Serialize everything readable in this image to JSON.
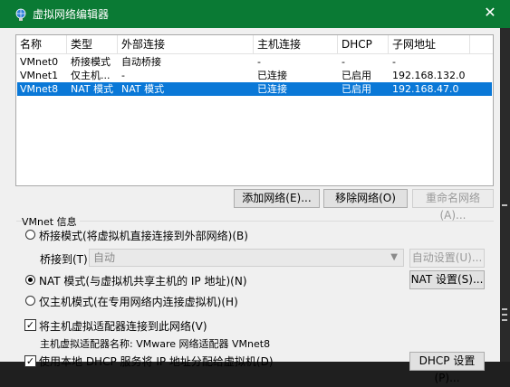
{
  "window": {
    "title": "虚拟网络编辑器",
    "close_glyph": "✕"
  },
  "table": {
    "columns": [
      "名称",
      "类型",
      "外部连接",
      "主机连接",
      "DHCP",
      "子网地址"
    ],
    "rows": [
      [
        "VMnet0",
        "桥接模式",
        "自动桥接",
        "-",
        "-",
        "-"
      ],
      [
        "VMnet1",
        "仅主机...",
        "-",
        "已连接",
        "已启用",
        "192.168.132.0"
      ],
      [
        "VMnet8",
        "NAT 模式",
        "NAT 模式",
        "已连接",
        "已启用",
        "192.168.47.0"
      ]
    ],
    "selected_row": 2
  },
  "buttons": {
    "add_network": "添加网络(E)...",
    "remove_network": "移除网络(O)",
    "rename_network": "重命名网络(A)..."
  },
  "vmnet_info": {
    "group_label": "VMnet 信息",
    "bridge_mode_label": "桥接模式(将虚拟机直接连接到外部网络)(B)",
    "bridge_to_label": "桥接到(T):",
    "bridge_to_value": "自动",
    "auto_settings": "自动设置(U)...",
    "nat_mode_label": "NAT 模式(与虚拟机共享主机的 IP 地址)(N)",
    "nat_settings": "NAT 设置(S)...",
    "host_only_label": "仅主机模式(在专用网络内连接虚拟机)(H)",
    "connect_adapter_label": "将主机虚拟适配器连接到此网络(V)",
    "adapter_name_label": "主机虚拟适配器名称: VMware 网络适配器 VMnet8",
    "dhcp_label": "使用本地 DHCP 服务将 IP 地址分配给虚拟机(D)",
    "dhcp_settings": "DHCP 设置(P)..."
  },
  "selected_mode": "nat",
  "colors": {
    "title_bar": "#0a7a34",
    "selection": "#0a78d7"
  }
}
